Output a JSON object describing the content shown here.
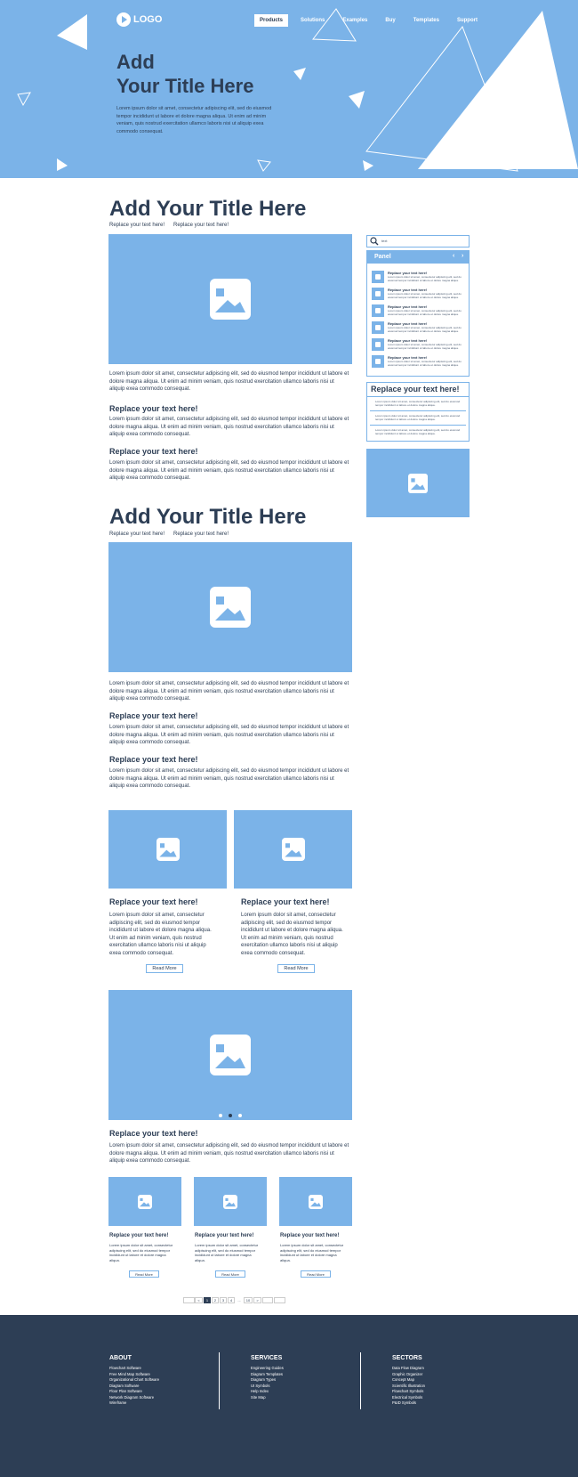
{
  "header": {
    "logo": "LOGO",
    "nav": [
      "Products",
      "Solutions",
      "Examples",
      "Buy",
      "Templates",
      "Support"
    ],
    "hero_title_1": "Add",
    "hero_title_2": "Your Title Here",
    "hero_text": "Lorem ipsum dolor sit amet, consectetur adipiscing elit, sed do eiusmod tempor incididunt ut labore et dolore magna aliqua. Ut enim ad minim veniam, quis nostrud exercitation ullamco laboris nisi ut aliquip exea commodo consequat."
  },
  "section1": {
    "title": "Add Your Title Here",
    "sub_1": "Replace your text here!",
    "sub_2": "Replace your text here!",
    "para": "Lorem ipsum dolor sit amet, consectetur adipiscing elit, sed do eiusmod tempor incididunt ut labore et dolore magna aliqua. Ut enim ad minim veniam, quis nostrud exercitation ullamco laboris nisi ut aliquip exea commodo consequat.",
    "h_1": "Replace your text here!",
    "para_1": "Lorem ipsum dolor sit amet, consectetur adipiscing elit, sed do eiusmod tempor incididunt ut labore et dolore magna aliqua. Ut enim ad minim veniam, quis nostrud exercitation ullamco laboris nisi ut aliquip exea commodo consequat.",
    "h_2": "Replace your text here!",
    "para_2": "Lorem ipsum dolor sit amet, consectetur adipiscing elit, sed do eiusmod tempor incididunt ut labore et dolore magna aliqua. Ut enim ad minim veniam, quis nostrud exercitation ullamco laboris nisi ut aliquip exea commodo consequat."
  },
  "sidebar": {
    "search_value": "text",
    "panel_title": "Panel",
    "panel_items": [
      {
        "title": "Replace your text here!",
        "text": "Lorem ipsum dolor sit amet, consectetur adipiscing elit, sed do eiusmod tempor incididunt ut labore et dolore magna aliqua."
      },
      {
        "title": "Replace your text here!",
        "text": "Lorem ipsum dolor sit amet, consectetur adipiscing elit, sed do eiusmod tempor incididunt ut labore et dolore magna aliqua."
      },
      {
        "title": "Replace your text here!",
        "text": "Lorem ipsum dolor sit amet, consectetur adipiscing elit, sed do eiusmod tempor incididunt ut labore et dolore magna aliqua."
      },
      {
        "title": "Replace your text here!",
        "text": "Lorem ipsum dolor sit amet, consectetur adipiscing elit, sed do eiusmod tempor incididunt ut labore et dolore magna aliqua."
      },
      {
        "title": "Replace your text here!",
        "text": "Lorem ipsum dolor sit amet, consectetur adipiscing elit, sed do eiusmod tempor incididunt ut labore et dolore magna aliqua."
      },
      {
        "title": "Replace your text here!",
        "text": "Lorem ipsum dolor sit amet, consectetur adipiscing elit, sed do eiusmod tempor incididunt ut labore et dolore magna aliqua."
      }
    ],
    "list_title": "Replace your text here!",
    "list_items": [
      "Lorem ipsum dolor sit amet, consectetur adipiscing elit, sed do eiusmod tempor incididunt ut labore et dolore magna aliqua.",
      "Lorem ipsum dolor sit amet, consectetur adipiscing elit, sed do eiusmod tempor incididunt ut labore et dolore magna aliqua.",
      "Lorem ipsum dolor sit amet, consectetur adipiscing elit, sed do eiusmod tempor incididunt ut labore et dolore magna aliqua."
    ]
  },
  "section2": {
    "title": "Add Your Title Here",
    "sub_1": "Replace your text here!",
    "sub_2": "Replace your text here!",
    "para": "Lorem ipsum dolor sit amet, consectetur adipiscing elit, sed do eiusmod tempor incididunt ut labore et dolore magna aliqua. Ut enim ad minim veniam, quis nostrud exercitation ullamco laboris nisi ut aliquip exea commodo consequat.",
    "h_1": "Replace your text here!",
    "para_1": "Lorem ipsum dolor sit amet, consectetur adipiscing elit, sed do eiusmod tempor incididunt ut labore et dolore magna aliqua. Ut enim ad minim veniam, quis nostrud exercitation ullamco laboris nisi ut aliquip exea commodo consequat.",
    "h_2": "Replace your text here!",
    "para_2": "Lorem ipsum dolor sit amet, consectetur adipiscing elit, sed do eiusmod tempor incididunt ut labore et dolore magna aliqua. Ut enim ad minim veniam, quis nostrud exercitation ullamco laboris nisi ut aliquip exea commodo consequat."
  },
  "cards2": [
    {
      "title": "Replace your text here!",
      "text": "Lorem ipsum dolor sit amet, consectetur adipiscing elit, sed do eiusmod tempor incididunt ut labore et dolore magna aliqua. Ut enim ad minim veniam, quis nostrud exercitation ullamco laboris nisi ut aliquip exea commodo consequat.",
      "button": "Read More"
    },
    {
      "title": "Replace your text here!",
      "text": "Lorem ipsum dolor sit amet, consectetur adipiscing elit, sed do eiusmod tempor incididunt ut labore et dolore magna aliqua. Ut enim ad minim veniam, quis nostrud exercitation ullamco laboris nisi ut aliquip exea commodo consequat.",
      "button": "Read More"
    }
  ],
  "slider": {
    "title": "Replace your text here!",
    "text": "Lorem ipsum dolor sit amet, consectetur adipiscing elit, sed do eiusmod tempor incididunt ut labore et dolore magna aliqua. Ut enim ad minim veniam, quis nostrud exercitation ullamco laboris nisi ut aliquip exea commodo consequat."
  },
  "cards3": [
    {
      "title": "Replace your text here!",
      "text": "Lorem ipsum dolor sit amet, consectetur adipiscing elit, sed do eiusmod tempor incididunt ut labore et dolore magna aliqua.",
      "button": "Read More"
    },
    {
      "title": "Replace your text here!",
      "text": "Lorem ipsum dolor sit amet, consectetur adipiscing elit, sed do eiusmod tempor incididunt ut labore et dolore magna aliqua.",
      "button": "Read More"
    },
    {
      "title": "Replace your text here!",
      "text": "Lorem ipsum dolor sit amet, consectetur adipiscing elit, sed do eiusmod tempor incididunt ut labore et dolore magna aliqua.",
      "button": "Read More"
    }
  ],
  "pagination": [
    "<",
    "1",
    "2",
    "3",
    "4",
    "...",
    "10",
    ">"
  ],
  "footer": {
    "about_title": "ABOUT",
    "about_links": [
      "Flowchart Software",
      "Free Mind Map Software",
      "Organizational Chart Software",
      "Diagram Software",
      "Floor Plan Software",
      "Network Diagram Software",
      "Wireframe"
    ],
    "services_title": "SERVICES",
    "services_links": [
      "Engineering Guides",
      "Diagram Templates",
      "Diagram Types",
      "UI Symbols",
      "Help Index",
      "Site Map"
    ],
    "sectors_title": "SECTORS",
    "sectors_links": [
      "Data Flow Diagram",
      "Graphic Organizer",
      "Concept Map",
      "Scientific Illustration",
      "Flowchart Symbols",
      "Electrical Symbols",
      "P&ID Symbols"
    ]
  },
  "colors": {
    "accent": "#7bb3e8",
    "dark": "#2d3e55"
  }
}
